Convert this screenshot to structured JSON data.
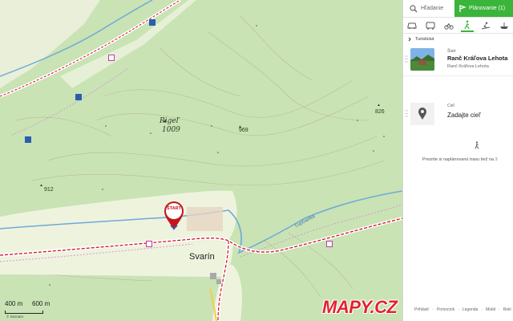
{
  "colors": {
    "accent": "#3ab43a",
    "brand_red": "#e5202e",
    "forest": "#c9e3b4",
    "meadow": "#eef3de",
    "route": "#d1122a",
    "river": "#6fa9d9"
  },
  "map": {
    "peak": {
      "name": "Rigeľ",
      "altitude": "1009"
    },
    "altitudes": [
      "969",
      "826",
      "912"
    ],
    "river_name": "Ľupčianka",
    "village": "Svarín",
    "start_label": "ŠTART",
    "scale": {
      "left": "400 m",
      "right": "600 m"
    },
    "logo": "MAPY.CZ",
    "copyright": "© Seznam"
  },
  "panel": {
    "tabs": {
      "search": "Hľadanie",
      "planning": "Plánovanie (1)"
    },
    "modes": [
      "car-icon",
      "bus-icon",
      "bike-icon",
      "walk-icon",
      "ski-icon",
      "boat-icon"
    ],
    "route_type": "Turistická",
    "start": {
      "caption": "Štart",
      "name": "Ranč Kráľova Lehota",
      "sub": "Ranč Kráľova Lehota"
    },
    "goal": {
      "caption": "Cieľ",
      "placeholder": "Zadajte cieľ"
    },
    "hint": "Prezrite si naplánovanú trasu tiež na",
    "hint_link": "3",
    "footer": [
      "Prihlásiť",
      "Pomocník",
      "Legenda",
      "Mobil",
      "Rekl"
    ]
  }
}
